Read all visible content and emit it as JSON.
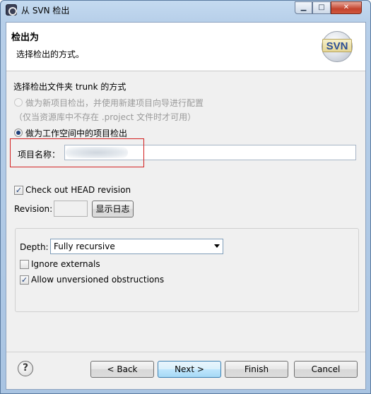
{
  "window": {
    "title": "从 SVN 检出",
    "minimize_glyph": "▁",
    "maximize_glyph": "□",
    "close_glyph": "✕"
  },
  "header": {
    "title": "检出为",
    "description": "选择检出的方式。",
    "logo_text": "SVN"
  },
  "checkout": {
    "section_label": "选择检出文件夹 trunk 的方式",
    "option_new_project": "做为新项目检出，并使用新建项目向导进行配置",
    "option_new_project_note": "（仅当资源库中不存在 .project 文件时才可用）",
    "option_workspace": "做为工作空间中的项目检出",
    "project_name_label": "项目名称：",
    "project_name_value": ""
  },
  "revision": {
    "head_label": "Check out HEAD revision",
    "head_checked": true,
    "revision_label": "Revision:",
    "revision_value": "",
    "show_log_label": "显示日志"
  },
  "options": {
    "depth_label": "Depth:",
    "depth_value": "Fully recursive",
    "ignore_externals_label": "Ignore externals",
    "ignore_externals_checked": false,
    "allow_unversioned_label": "Allow unversioned obstructions",
    "allow_unversioned_checked": true
  },
  "footer": {
    "help_glyph": "?",
    "back_label": "< Back",
    "next_label": "Next >",
    "finish_label": "Finish",
    "cancel_label": "Cancel"
  }
}
